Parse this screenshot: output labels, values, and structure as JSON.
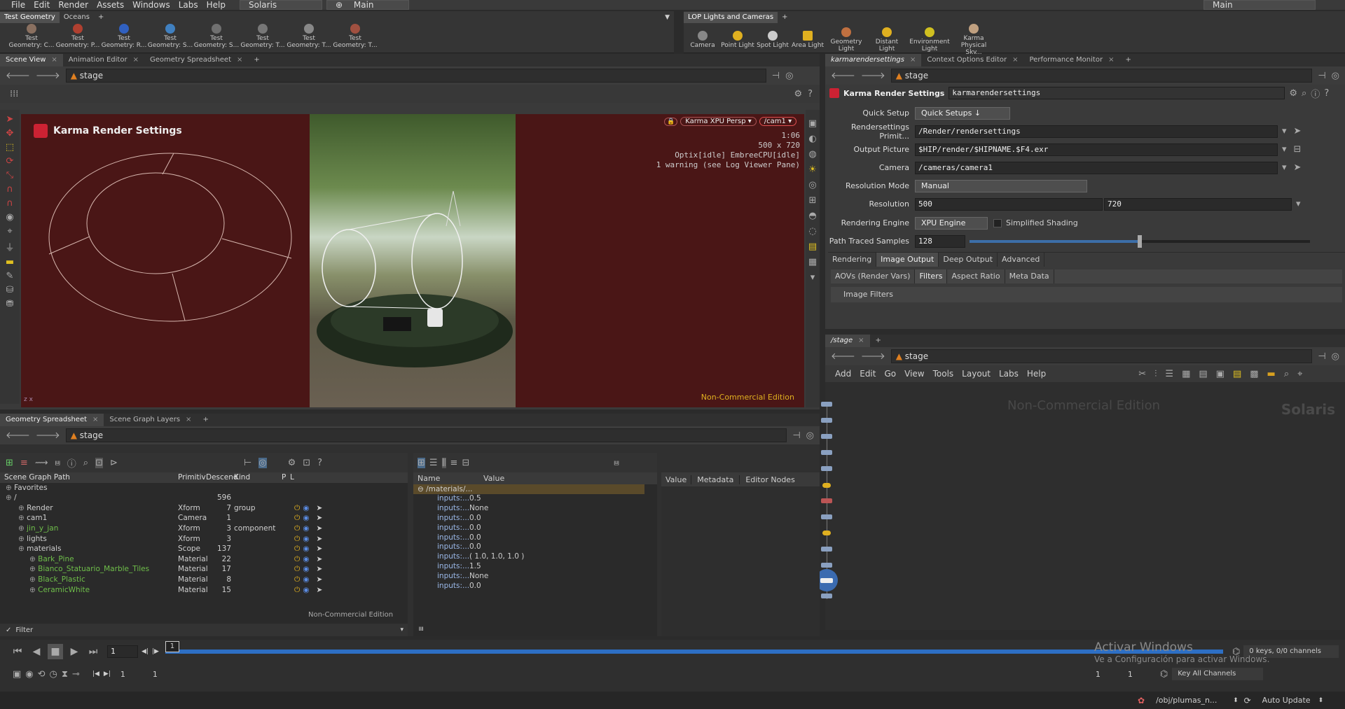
{
  "menubar": {
    "items": [
      "File",
      "Edit",
      "Render",
      "Assets",
      "Windows",
      "Labs",
      "Help"
    ],
    "desktop": "Solaris",
    "network": "Main",
    "right_desktop": "Main"
  },
  "shelf_left": {
    "tabs": [
      "Test Geometry",
      "Oceans"
    ],
    "tools": [
      "Test Geometry: C...",
      "Test Geometry: P...",
      "Test Geometry: R...",
      "Test Geometry: S...",
      "Test Geometry: S...",
      "Test Geometry: T...",
      "Test Geometry: T...",
      "Test Geometry: T..."
    ]
  },
  "shelf_right": {
    "tabs": [
      "LOP Lights and Cameras"
    ],
    "tools": [
      "Camera",
      "Point Light",
      "Spot Light",
      "Area Light",
      "Geometry Light",
      "Distant Light",
      "Environment Light",
      "Karma Physical Sky..."
    ]
  },
  "viewport": {
    "tabs": [
      "Scene View",
      "Animation Editor",
      "Geometry Spreadsheet"
    ],
    "path": "stage",
    "hud_title": "Karma Render Settings",
    "renderer": "Karma XPU Persp",
    "camera": "/cam1",
    "info": [
      "1:06",
      "500 x 720",
      "Optix[idle] EmbreeCPU[idle]",
      "1 warning (see Log Viewer Pane)"
    ],
    "watermark": "Non-Commercial Edition",
    "bg_color": "#4a1616"
  },
  "params": {
    "tabs": [
      "karmarendersettings",
      "Context Options Editor",
      "Performance Monitor"
    ],
    "path": "stage",
    "node_type": "Karma Render Settings",
    "node_name": "karmarendersettings",
    "rows": {
      "quick_setup_label": "Quick Setup",
      "quick_setup_value": "Quick Setups",
      "primitive_label": "Rendersettings Primit...",
      "primitive_value": "/Render/rendersettings",
      "output_label": "Output Picture",
      "output_value": "$HIP/render/$HIPNAME.$F4.exr",
      "camera_label": "Camera",
      "camera_value": "/cameras/camera1",
      "resmode_label": "Resolution Mode",
      "resmode_value": "Manual",
      "resolution_label": "Resolution",
      "res_x": "500",
      "res_y": "720",
      "engine_label": "Rendering Engine",
      "engine_value": "XPU Engine",
      "simplified_label": "Simplified Shading",
      "samples_label": "Path Traced Samples",
      "samples_value": "128"
    },
    "samples_level": 0.5,
    "tabs_main": [
      "Rendering",
      "Image Output",
      "Deep Output",
      "Advanced"
    ],
    "tabs_sub": [
      "AOVs (Render Vars)",
      "Filters",
      "Aspect Ratio",
      "Meta Data"
    ],
    "image_filters": "Image Filters"
  },
  "network": {
    "tab": "/stage",
    "path": "stage",
    "menu": [
      "Add",
      "Edit",
      "Go",
      "View",
      "Tools",
      "Layout",
      "Labs",
      "Help"
    ],
    "watermark": "Non-Commercial Edition",
    "context": "Solaris"
  },
  "scenegraph": {
    "tabs": [
      "Geometry Spreadsheet",
      "Scene Graph Layers"
    ],
    "path": "stage",
    "headers": [
      "Scene Graph Path",
      "Primitiv",
      "Descend",
      "Kind",
      "P",
      "L"
    ],
    "rows": [
      {
        "name": "Favorites",
        "type": "",
        "count": "",
        "kind": "",
        "green": false
      },
      {
        "name": "/",
        "type": "",
        "count": "596",
        "kind": "",
        "green": false
      },
      {
        "name": "Render",
        "type": "Xform",
        "count": "7",
        "kind": "group",
        "green": false
      },
      {
        "name": "cam1",
        "type": "Camera",
        "count": "1",
        "kind": "",
        "green": false
      },
      {
        "name": "jin_y_jan",
        "type": "Xform",
        "count": "3",
        "kind": "component",
        "green": true
      },
      {
        "name": "lights",
        "type": "Xform",
        "count": "3",
        "kind": "",
        "green": false
      },
      {
        "name": "materials",
        "type": "Scope",
        "count": "137",
        "kind": "",
        "green": false
      },
      {
        "name": "Bark_Pine",
        "type": "Material",
        "count": "22",
        "kind": "",
        "green": true
      },
      {
        "name": "Bianco_Statuario_Marble_Tiles",
        "type": "Material",
        "count": "17",
        "kind": "",
        "green": true
      },
      {
        "name": "Black_Plastic",
        "type": "Material",
        "count": "8",
        "kind": "",
        "green": true
      },
      {
        "name": "CeramicWhite",
        "type": "Material",
        "count": "15",
        "kind": "",
        "green": true
      }
    ],
    "watermark": "Non-Commercial Edition",
    "filter": "Filter"
  },
  "properties": {
    "headers": [
      "Name",
      "Value"
    ],
    "group": "/materials/...",
    "rows": [
      {
        "n": "inputs:...",
        "v": "0.5"
      },
      {
        "n": "inputs:...",
        "v": "None"
      },
      {
        "n": "inputs:...",
        "v": "0.0"
      },
      {
        "n": "inputs:...",
        "v": "0.0"
      },
      {
        "n": "inputs:...",
        "v": "0.0"
      },
      {
        "n": "inputs:...",
        "v": "0.0"
      },
      {
        "n": "inputs:...",
        "v": "( 1.0, 1.0, 1.0 )"
      },
      {
        "n": "inputs:...",
        "v": "1.5"
      },
      {
        "n": "inputs:...",
        "v": "None"
      },
      {
        "n": "inputs:...",
        "v": "0.0"
      }
    ],
    "side_tabs": [
      "Value",
      "Metadata",
      "Editor Nodes"
    ]
  },
  "timeline": {
    "frame": "1",
    "marker": "1",
    "start": "1",
    "end": "1",
    "keys": "0 keys, 0/0 channels",
    "channels": "Key All Channels",
    "end_field": "1",
    "end_field2": "1"
  },
  "status": {
    "obj_path": "/obj/plumas_n...",
    "update": "Auto Update"
  },
  "activation": {
    "title": "Activar Windows",
    "sub": "Ve a Configuración para activar Windows."
  }
}
